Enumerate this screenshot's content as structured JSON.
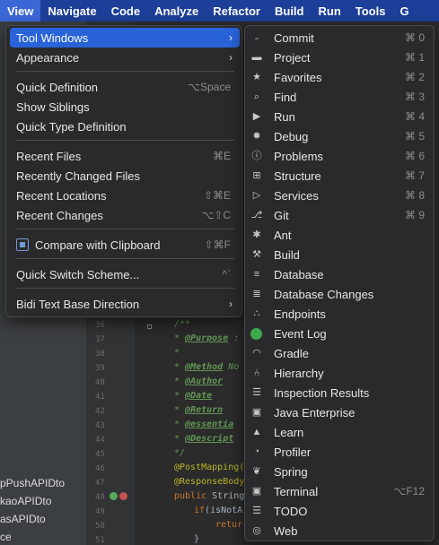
{
  "menubar": {
    "items": [
      "View",
      "Navigate",
      "Code",
      "Analyze",
      "Refactor",
      "Build",
      "Run",
      "Tools",
      "G"
    ],
    "active": "View"
  },
  "view_menu": {
    "items": [
      {
        "label": "Tool Windows",
        "shortcut": "",
        "submenu": true,
        "selected": true
      },
      {
        "label": "Appearance",
        "shortcut": "",
        "submenu": true
      },
      {
        "label": "Quick Definition",
        "shortcut": "⌥Space"
      },
      {
        "label": "Show Siblings",
        "shortcut": ""
      },
      {
        "label": "Quick Type Definition",
        "shortcut": ""
      },
      {
        "label": "Recent Files",
        "shortcut": "⌘E"
      },
      {
        "label": "Recently Changed Files",
        "shortcut": ""
      },
      {
        "label": "Recent Locations",
        "shortcut": "⇧⌘E"
      },
      {
        "label": "Recent Changes",
        "shortcut": "⌥⇧C"
      },
      {
        "label": "Compare with Clipboard",
        "shortcut": "⇧⌘F"
      },
      {
        "label": "Quick Switch Scheme...",
        "shortcut": "^`"
      },
      {
        "label": "Bidi Text Base Direction",
        "shortcut": "",
        "submenu": true
      }
    ]
  },
  "tool_windows": {
    "items": [
      {
        "label": "Commit",
        "shortcut": "⌘ 0",
        "icon": "commit-icon"
      },
      {
        "label": "Project",
        "shortcut": "⌘ 1",
        "icon": "folder-icon"
      },
      {
        "label": "Favorites",
        "shortcut": "⌘ 2",
        "icon": "star-icon"
      },
      {
        "label": "Find",
        "shortcut": "⌘ 3",
        "icon": "search-icon"
      },
      {
        "label": "Run",
        "shortcut": "⌘ 4",
        "icon": "play-icon"
      },
      {
        "label": "Debug",
        "shortcut": "⌘ 5",
        "icon": "bug-icon"
      },
      {
        "label": "Problems",
        "shortcut": "⌘ 6",
        "icon": "warning-icon"
      },
      {
        "label": "Structure",
        "shortcut": "⌘ 7",
        "icon": "structure-icon"
      },
      {
        "label": "Services",
        "shortcut": "⌘ 8",
        "icon": "services-icon"
      },
      {
        "label": "Git",
        "shortcut": "⌘ 9",
        "icon": "git-branch-icon"
      },
      {
        "label": "Ant",
        "shortcut": "",
        "icon": "ant-icon"
      },
      {
        "label": "Build",
        "shortcut": "",
        "icon": "hammer-icon"
      },
      {
        "label": "Database",
        "shortcut": "",
        "icon": "database-icon"
      },
      {
        "label": "Database Changes",
        "shortcut": "",
        "icon": "database-changes-icon"
      },
      {
        "label": "Endpoints",
        "shortcut": "",
        "icon": "endpoints-icon"
      },
      {
        "label": "Event Log",
        "shortcut": "",
        "icon": "event-log-icon"
      },
      {
        "label": "Gradle",
        "shortcut": "",
        "icon": "gradle-icon"
      },
      {
        "label": "Hierarchy",
        "shortcut": "",
        "icon": "hierarchy-icon"
      },
      {
        "label": "Inspection Results",
        "shortcut": "",
        "icon": "inspection-icon"
      },
      {
        "label": "Java Enterprise",
        "shortcut": "",
        "icon": "java-enterprise-icon"
      },
      {
        "label": "Learn",
        "shortcut": "",
        "icon": "learn-icon"
      },
      {
        "label": "Profiler",
        "shortcut": "",
        "icon": "profiler-icon"
      },
      {
        "label": "Spring",
        "shortcut": "",
        "icon": "spring-icon"
      },
      {
        "label": "Terminal",
        "shortcut": "⌥F12",
        "icon": "terminal-icon"
      },
      {
        "label": "TODO",
        "shortcut": "",
        "icon": "todo-icon"
      },
      {
        "label": "Web",
        "shortcut": "",
        "icon": "globe-icon"
      }
    ]
  },
  "project_tree": {
    "items": [
      "pPushAPIDto",
      "kaoAPIDto",
      "asAPIDto",
      "ce"
    ]
  },
  "editor": {
    "line_numbers": [
      "36",
      "37",
      "38",
      "39",
      "40",
      "41",
      "42",
      "43",
      "44",
      "45",
      "46",
      "47",
      "48",
      "49",
      "50",
      "51"
    ],
    "lines": {
      "l36": "/**",
      "l37_tag": "@Purpose",
      "l37_rest": " :",
      "l38": "*",
      "l39_tag": "@Method",
      "l39_rest": " No",
      "l40_tag": "@Author",
      "l41_tag": "@Date",
      "l42_tag": "@Return",
      "l43_tag": "@essentia",
      "l44_tag": "@Descript",
      "l45": "*/",
      "l46": "@PostMapping(",
      "l47": "@ResponseBody",
      "l48_kw": "public ",
      "l48_rest": "String",
      "l49_kw": "if",
      "l49_rest": "(isNotA",
      "l50_kw": "retur",
      "l51": "}"
    }
  }
}
